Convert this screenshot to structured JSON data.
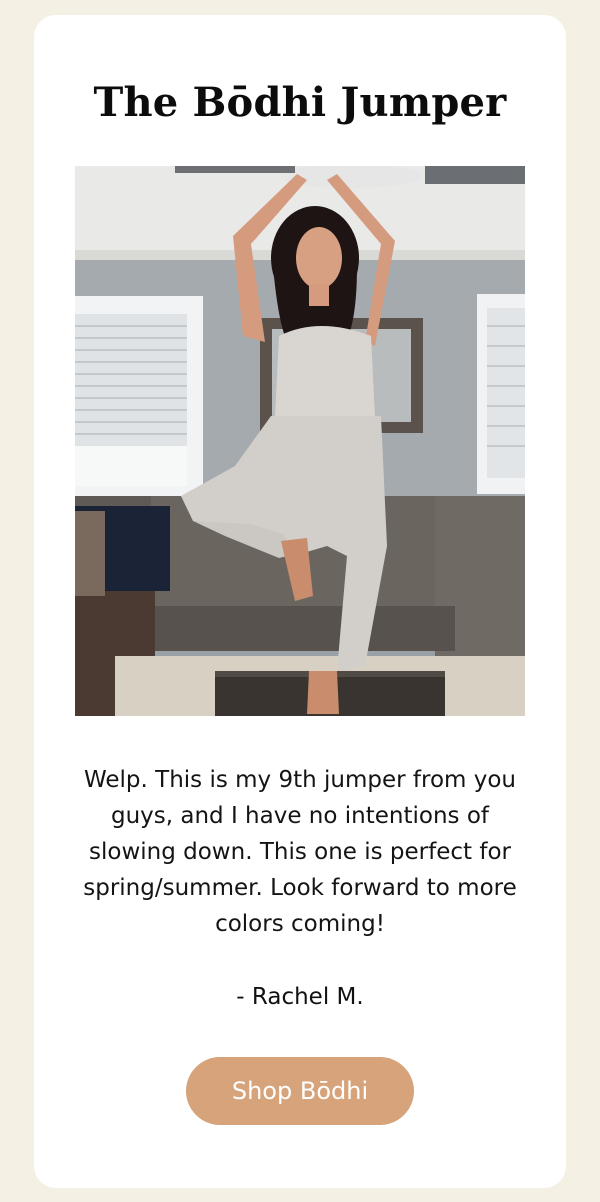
{
  "header": {
    "title": "The Bōdhi Jumper"
  },
  "photo": {
    "description_icon": "customer-photo"
  },
  "testimonial": {
    "text": "Welp. This is my 9th jumper from you guys, and I have no intentions of slowing down. This one is perfect for spring/summer. Look forward to more colors coming!",
    "author": "- Rachel M."
  },
  "cta": {
    "label": "Shop Bōdhi"
  },
  "colors": {
    "page_background": "#f4f0e4",
    "card_background": "#ffffff",
    "button_background": "#d6a37a",
    "button_text": "#ffffff"
  }
}
